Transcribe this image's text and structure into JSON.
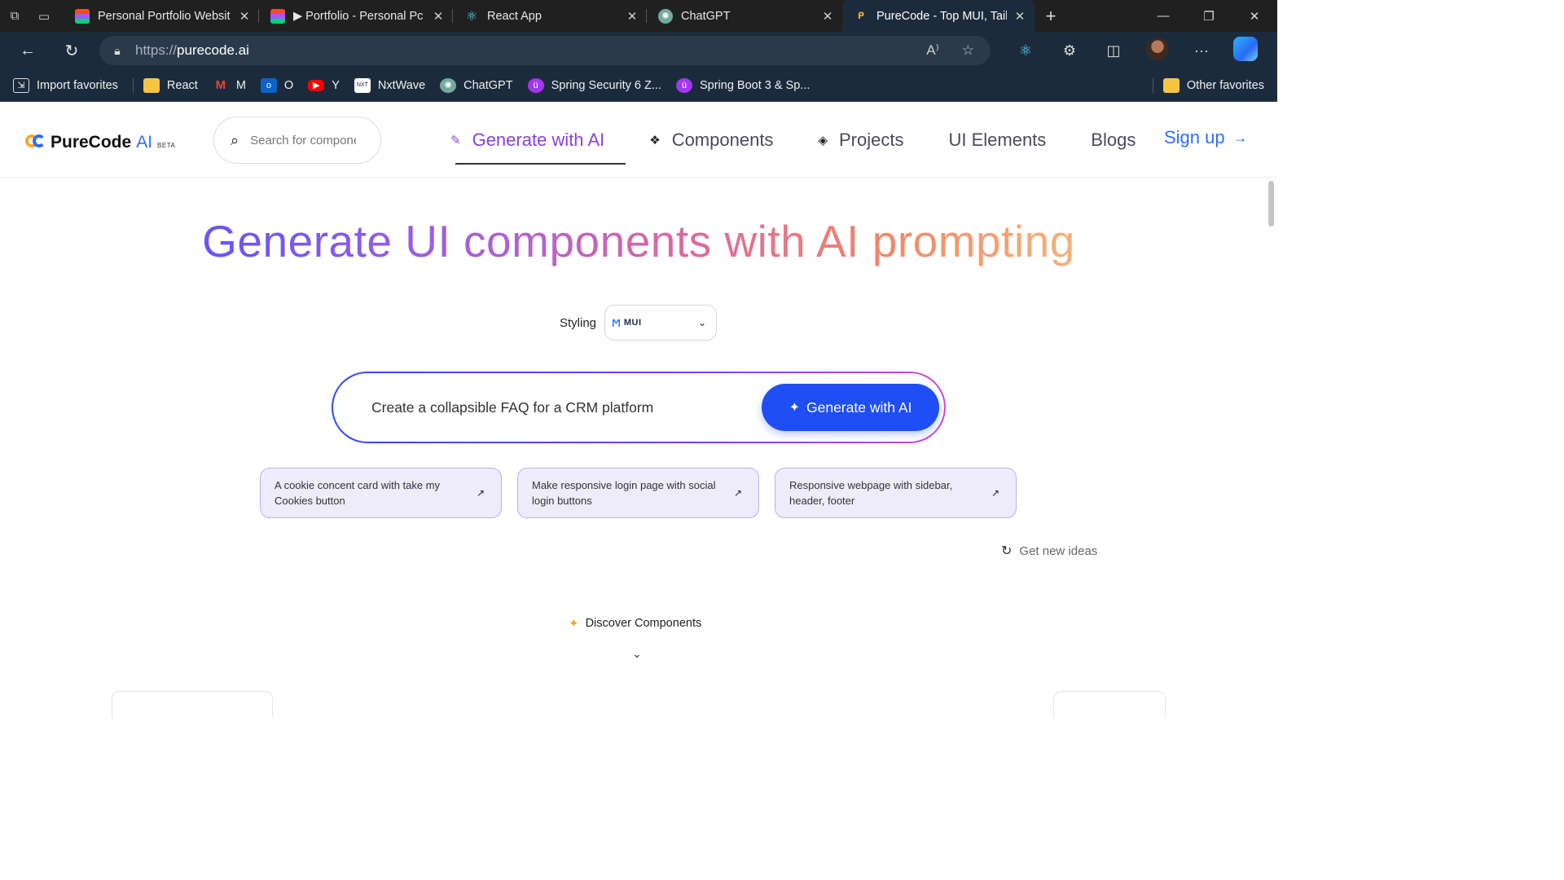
{
  "browser": {
    "tabs": [
      {
        "title": "Personal Portfolio Websit",
        "icon": "figma-icon",
        "active": false
      },
      {
        "title": "▶ Portfolio - Personal Pc",
        "icon": "figma-icon",
        "active": false
      },
      {
        "title": "React App",
        "icon": "react-icon",
        "active": false
      },
      {
        "title": "ChatGPT",
        "icon": "chatgpt-icon",
        "active": false
      },
      {
        "title": "PureCode - Top MUI, Tail",
        "icon": "purecode-icon",
        "active": true
      }
    ],
    "url_prefix": "https://",
    "url_host": "purecode.ai",
    "bookmarks": [
      {
        "label": "Import favorites",
        "icon": "import-icon"
      },
      {
        "label": "React",
        "icon": "folder-icon"
      },
      {
        "label": "M",
        "icon": "gmail-icon"
      },
      {
        "label": "O",
        "icon": "outlook-icon"
      },
      {
        "label": "Y",
        "icon": "youtube-icon"
      },
      {
        "label": "NxtWave",
        "icon": "nxtwave-icon"
      },
      {
        "label": "ChatGPT",
        "icon": "chatgpt-icon"
      },
      {
        "label": "Spring Security 6 Z...",
        "icon": "udemy-icon"
      },
      {
        "label": "Spring Boot 3 & Sp...",
        "icon": "udemy-icon"
      }
    ],
    "other_favorites": "Other favorites"
  },
  "site": {
    "logo_text": "PureCode",
    "logo_ai": "AI",
    "logo_badge": "BETA",
    "search_placeholder": "Search for components",
    "nav": [
      {
        "label": "Generate with AI",
        "icon": "magic-wand-icon",
        "active": true
      },
      {
        "label": "Components",
        "icon": "components-icon",
        "active": false
      },
      {
        "label": "Projects",
        "icon": "layers-icon",
        "active": false
      },
      {
        "label": "UI Elements",
        "icon": "",
        "active": false
      },
      {
        "label": "Blogs",
        "icon": "",
        "active": false
      }
    ],
    "signup": "Sign up"
  },
  "hero": {
    "title": "Generate UI components with AI prompting",
    "styling_label": "Styling",
    "styling_value": "MUI",
    "prompt_text": "Create a collapsible FAQ for a CRM platform",
    "generate_button": "Generate with AI"
  },
  "ideas": [
    "A cookie concent card with take my Cookies button",
    "Make responsive login page with social login buttons",
    "Responsive webpage with sidebar, header, footer"
  ],
  "get_new_ideas": "Get new ideas",
  "discover": "Discover Components",
  "colors": {
    "accent": "#2f6bff",
    "nav_active": "#8a3fe0",
    "chrome_bg": "#1c2b3c",
    "idea_bg": "#eeebfb"
  }
}
